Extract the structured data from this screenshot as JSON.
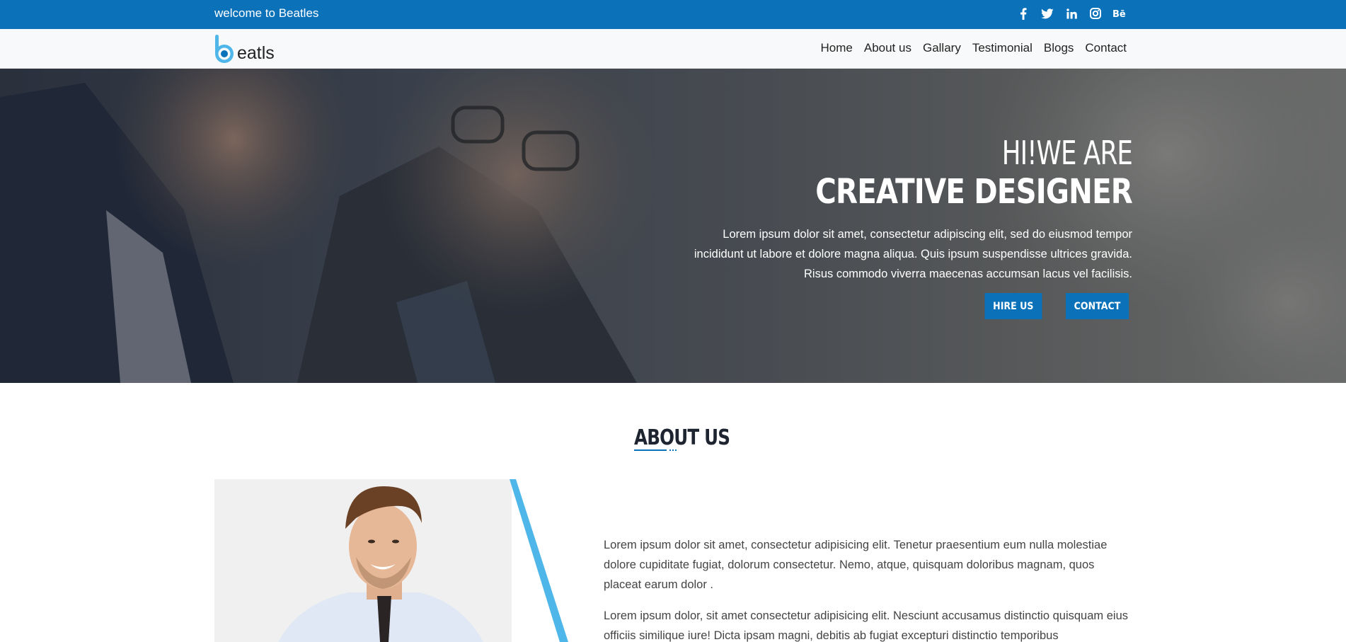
{
  "topbar": {
    "welcome": "welcome to Beatles",
    "social": [
      {
        "icon": "facebook-icon",
        "glyph": "f"
      },
      {
        "icon": "twitter-icon",
        "glyph": "t"
      },
      {
        "icon": "linkedin-icon",
        "glyph": "in"
      },
      {
        "icon": "instagram-icon",
        "glyph": "ig"
      },
      {
        "icon": "behance-icon",
        "glyph": "Bē"
      }
    ]
  },
  "logo": {
    "text": "eatls"
  },
  "nav": {
    "items": [
      "Home",
      "About us",
      "Gallary",
      "Testimonial",
      "Blogs",
      "Contact"
    ]
  },
  "hero": {
    "line1": "HI!WE ARE",
    "line2": "CREATIVE DESIGNER",
    "desc": [
      "Lorem ipsum dolor sit amet, consectetur adipiscing elit, sed do eiusmod tempor",
      "incididunt ut labore et dolore magna aliqua. Quis ipsum suspendisse ultrices gravida.",
      "Risus commodo viverra maecenas accumsan lacus vel facilisis."
    ],
    "hire_label": "HIRE US",
    "contact_label": "CONTACT"
  },
  "about": {
    "title": "ABOUT US",
    "para1": "Lorem ipsum dolor sit amet, consectetur adipisicing elit. Tenetur praesentium eum nulla molestiae dolore cupiditate fugiat, dolorum consectetur. Nemo, atque, quisquam doloribus magnam, quos placeat earum dolor .",
    "para2": "Lorem ipsum dolor, sit amet consectetur adipisicing elit. Nesciunt accusamus distinctio quisquam eius officiis similique iure! Dicta ipsam magni, debitis ab fugiat excepturi distinctio temporibus"
  },
  "colors": {
    "accent": "#0b72ba",
    "accent_light": "#4fb6ea"
  }
}
